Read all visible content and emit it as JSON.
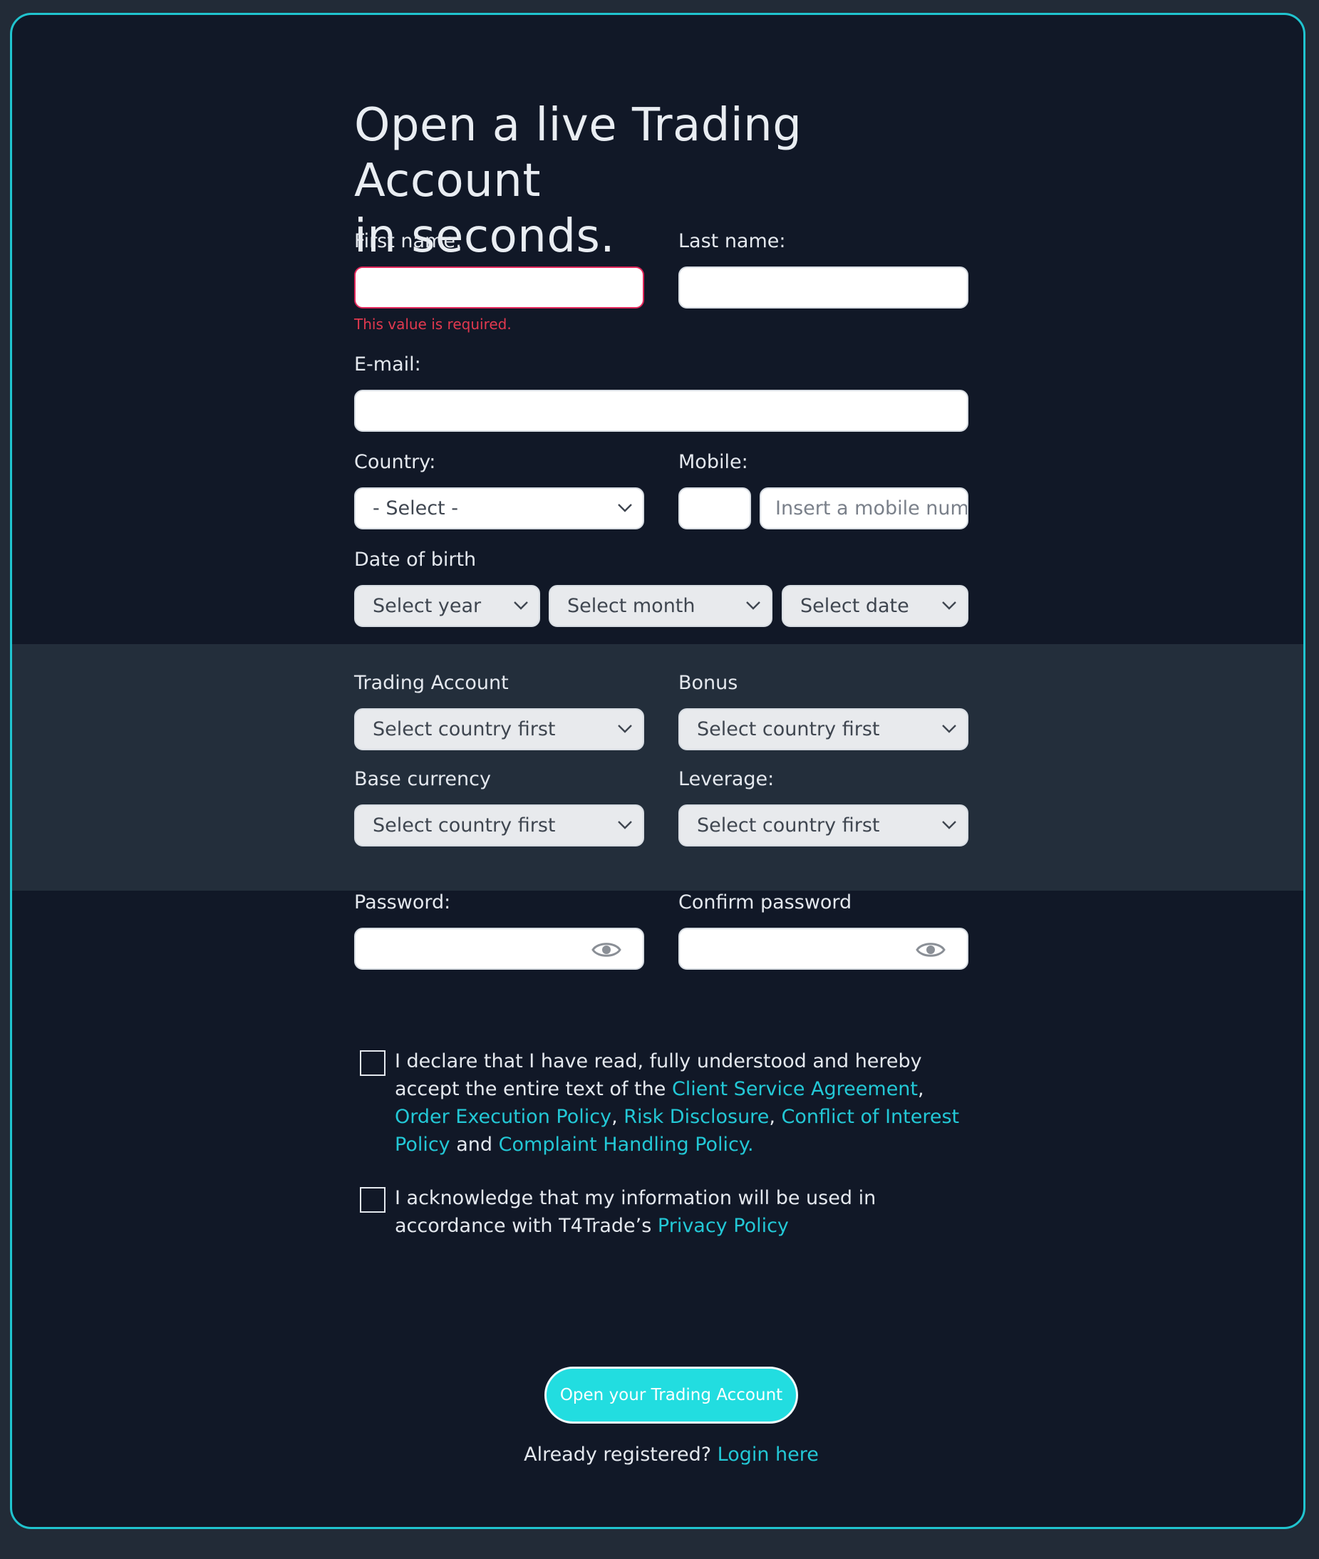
{
  "page": {
    "title_line1": "Open a live Trading Account",
    "title_line2": "in seconds."
  },
  "form": {
    "first_name": {
      "label": "First name:",
      "value": "",
      "error": "This value is required."
    },
    "last_name": {
      "label": "Last name:",
      "value": ""
    },
    "email": {
      "label": "E-mail:",
      "value": ""
    },
    "country": {
      "label": "Country:",
      "selected": "- Select -"
    },
    "mobile": {
      "label": "Mobile:",
      "code_value": "",
      "placeholder": "Insert a mobile numb"
    },
    "dob": {
      "label": "Date of birth",
      "year": "Select year",
      "month": "Select month",
      "date": "Select date"
    },
    "trading_account": {
      "label": "Trading Account",
      "selected": "Select country first"
    },
    "bonus": {
      "label": "Bonus",
      "selected": "Select country first"
    },
    "base_currency": {
      "label": "Base currency",
      "selected": "Select country first"
    },
    "leverage": {
      "label": "Leverage:",
      "selected": "Select country first"
    },
    "password": {
      "label": "Password:",
      "value": ""
    },
    "confirm_password": {
      "label": "Confirm password",
      "value": ""
    }
  },
  "consent": {
    "declare": {
      "text_1": "I declare that I have read, fully understood and hereby accept the entire text of the ",
      "link_csa": "Client Service Agreement",
      "sep_1": ", ",
      "link_oep": "Order Execution Policy",
      "sep_2": ", ",
      "link_rd": "Risk Disclosure",
      "sep_3": ", ",
      "link_coi": "Conflict of Interest Policy",
      "sep_4": " and ",
      "link_chp": "Complaint Handling Policy.",
      "checked": false
    },
    "privacy": {
      "text_1": "I acknowledge that my information will be used in accordance with T4Trade’s ",
      "link_pp": "Privacy Policy",
      "checked": false
    }
  },
  "submit": {
    "label": "Open your Trading Account"
  },
  "footer": {
    "text": "Already registered? ",
    "link": "Login here"
  },
  "colors": {
    "accent": "#22dde0",
    "link": "#23c8d6",
    "error": "#e2394f",
    "background": "#111827",
    "band": "#232e3b"
  },
  "icons": {
    "select_arrow": "chevron-down-icon",
    "password_toggle": "eye-icon"
  }
}
